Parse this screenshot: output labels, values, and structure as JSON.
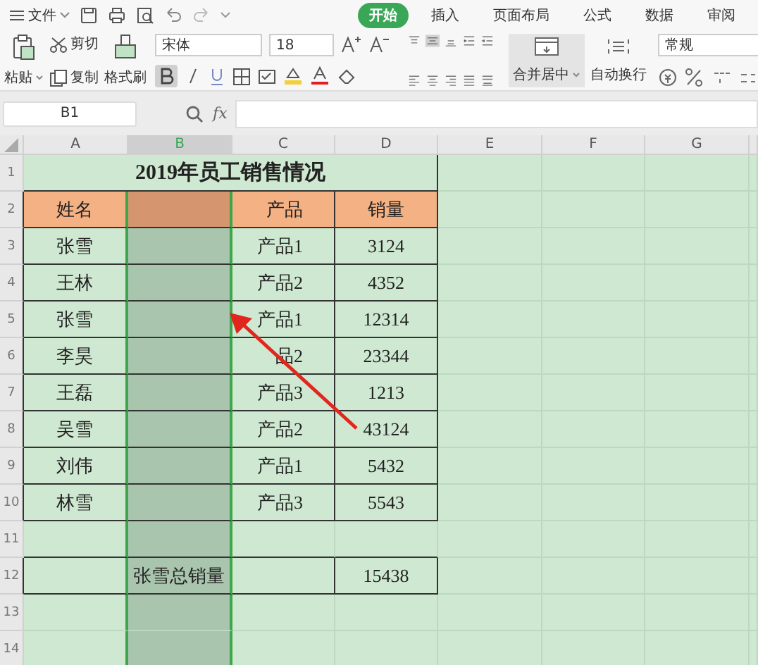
{
  "menu": {
    "file": "文件",
    "tabs": [
      {
        "label": "开始",
        "selected": true
      },
      {
        "label": "插入",
        "selected": false
      },
      {
        "label": "页面布局",
        "selected": false
      },
      {
        "label": "公式",
        "selected": false
      },
      {
        "label": "数据",
        "selected": false
      },
      {
        "label": "审阅",
        "selected": false
      }
    ]
  },
  "toolbar": {
    "paste": "粘贴",
    "cut": "剪切",
    "copy": "复制",
    "format_painter": "格式刷",
    "font": "宋体",
    "font_size": "18",
    "bold_on": true,
    "merge": "合并居中",
    "wrap": "自动换行",
    "number_format": "常规"
  },
  "formula_bar": {
    "name_box": "B1",
    "fx": "fx"
  },
  "sheet": {
    "columns": [
      {
        "label": "A",
        "selected": false
      },
      {
        "label": "B",
        "selected": true
      },
      {
        "label": "C",
        "selected": false
      },
      {
        "label": "D",
        "selected": false
      },
      {
        "label": "E",
        "selected": false
      },
      {
        "label": "F",
        "selected": false
      },
      {
        "label": "G",
        "selected": false
      }
    ],
    "rows": [
      {
        "number": "1",
        "kind": "title",
        "title": "2019年员工销售情况"
      },
      {
        "number": "2",
        "kind": "header",
        "name": "姓名",
        "product": "产品",
        "sales": "销量"
      },
      {
        "number": "3",
        "kind": "data",
        "name": "张雪",
        "product": "产品1",
        "sales": "3124"
      },
      {
        "number": "4",
        "kind": "data",
        "name": "王林",
        "product": "产品2",
        "sales": "4352"
      },
      {
        "number": "5",
        "kind": "data",
        "name": "张雪",
        "product": "产品1",
        "sales": "12314"
      },
      {
        "number": "6",
        "kind": "data",
        "name": "李昊",
        "product": "品2",
        "sales": "23344"
      },
      {
        "number": "7",
        "kind": "data",
        "name": "王磊",
        "product": "产品3",
        "sales": "1213"
      },
      {
        "number": "8",
        "kind": "data",
        "name": "吴雪",
        "product": "产品2",
        "sales": "43124"
      },
      {
        "number": "9",
        "kind": "data",
        "name": "刘伟",
        "product": "产品1",
        "sales": "5432"
      },
      {
        "number": "10",
        "kind": "data",
        "name": "林雪",
        "product": "产品3",
        "sales": "5543"
      },
      {
        "number": "11",
        "kind": "blank"
      },
      {
        "number": "12",
        "kind": "total",
        "label": "张雪总销量",
        "value": "15438"
      },
      {
        "number": "13",
        "kind": "blank"
      },
      {
        "number": "14",
        "kind": "blank"
      }
    ]
  }
}
